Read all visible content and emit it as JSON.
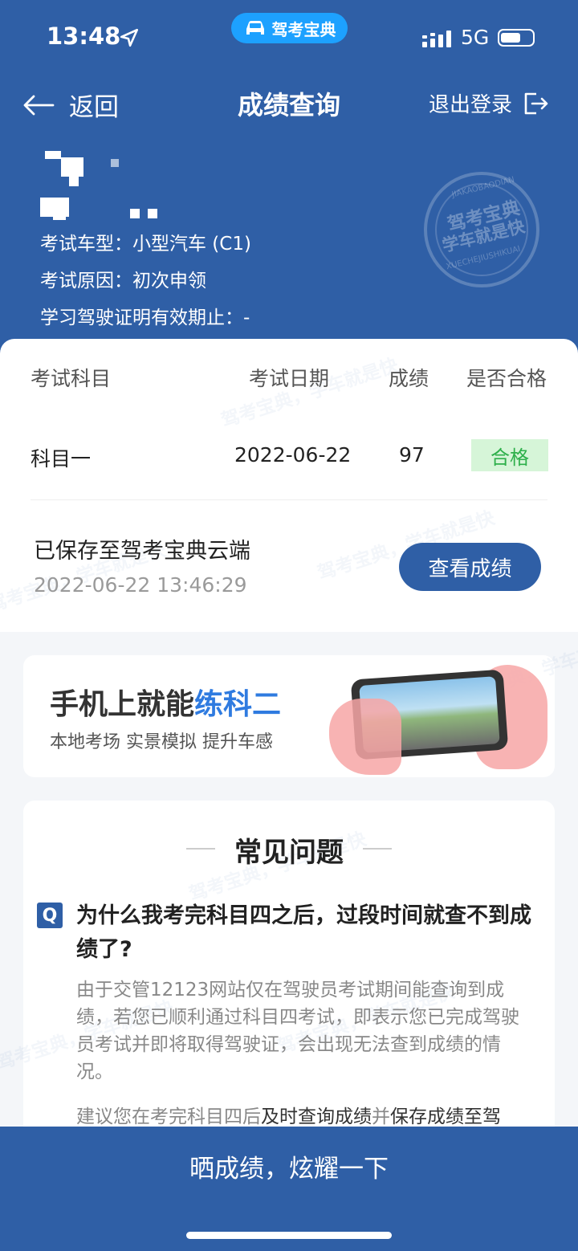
{
  "status": {
    "time": "13:48",
    "network": "5G",
    "app_badge": "驾考宝典"
  },
  "nav": {
    "back_label": "返回",
    "title": "成绩查询",
    "logout_label": "退出登录"
  },
  "exam_info": {
    "vehicle_type": "考试车型：小型汽车 (C1)",
    "reason": "考试原因：初次申领",
    "permit_expiry": "学习驾驶证明有效期止：-"
  },
  "stamp": {
    "main": "驾考宝典",
    "sub": "学车就是快",
    "top": "JIAKAOBAODIAN",
    "bottom": "XUECHEJIUSHIKUAI"
  },
  "results_table": {
    "headers": [
      "考试科目",
      "考试日期",
      "成绩",
      "是否合格"
    ],
    "rows": [
      {
        "subject": "科目一",
        "date": "2022-06-22",
        "score": "97",
        "status": "合格"
      }
    ]
  },
  "saved": {
    "label": "已保存至驾考宝典云端",
    "timestamp": "2022-06-22 13:46:29",
    "button": "查看成绩"
  },
  "watermark": [
    "驾考宝典，学车就是快"
  ],
  "banner": {
    "title_prefix": "手机上就能",
    "title_highlight": "练科二",
    "subtitle": "本地考场 实景模拟 提升车感"
  },
  "faq": {
    "title": "常见问题",
    "q_badge": "Q",
    "question": "为什么我考完科目四之后，过段时间就查不到成绩了?",
    "answer": "由于交管12123网站仅在驾驶员考试期间能查询到成绩，若您已顺利通过科目四考试，即表示您已完成驾驶员考试并即将取得驾驶证，会出现无法查到成绩的情况。",
    "answer2_a": "建议您在考完科目四后",
    "answer2_b": "及时查询成绩",
    "answer2_c": "并",
    "answer2_d": "保存成绩至驾"
  },
  "bottom": {
    "share_label": "晒成绩，炫耀一下"
  },
  "colors": {
    "brand_blue": "#2f5fa6",
    "pass_green": "#2eb04b",
    "highlight": "#2f7be0"
  }
}
